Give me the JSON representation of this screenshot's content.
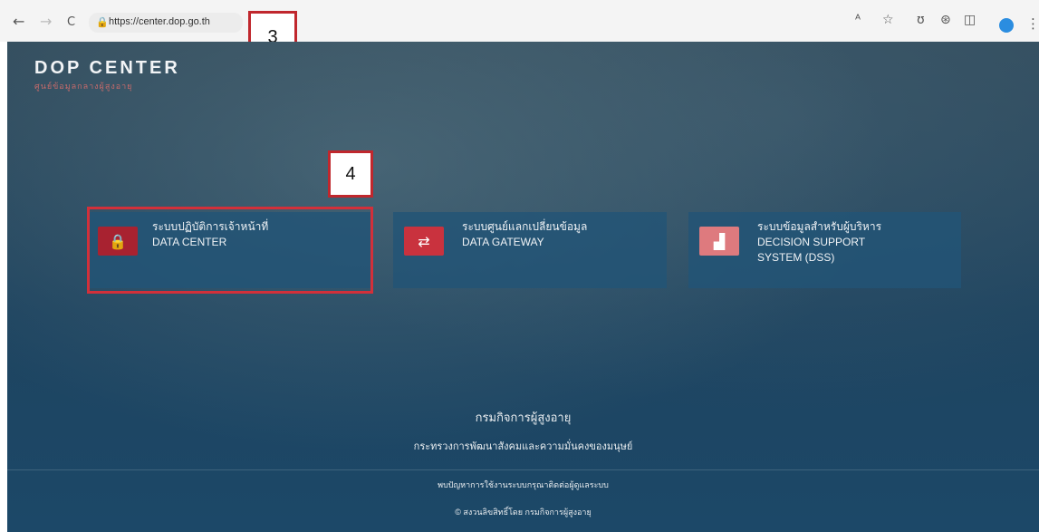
{
  "browser": {
    "back_icon": "←",
    "forward_icon": "→",
    "reload_icon": "C",
    "lock_icon": "🔒",
    "url": "https://center.dop.go.th",
    "extensions": [
      "translate-icon",
      "star-icon",
      "extension-icon",
      "sync-icon",
      "camera-icon"
    ],
    "ext_glyphs": [
      "ᴬ",
      "☆",
      "ʊ",
      "⊛",
      "◫"
    ],
    "kebab": "⋮"
  },
  "callouts": {
    "three": "3",
    "four": "4"
  },
  "header": {
    "title": "DOP CENTER",
    "subtitle": "ศูนย์ข้อมูลกลางผู้สูงอายุ"
  },
  "cards": [
    {
      "line1": "ระบบปฏิบัติการเจ้าหน้าที่",
      "line2": "DATA CENTER",
      "line3": "",
      "icon": "lock-icon",
      "glyph": "🔒",
      "color": "#a82230"
    },
    {
      "line1": "ระบบศูนย์แลกเปลี่ยนข้อมูล",
      "line2": "DATA GATEWAY",
      "line3": "",
      "icon": "exchange-icon",
      "glyph": "⇄",
      "color": "#c9323e"
    },
    {
      "line1": "ระบบข้อมูลสำหรับผู้บริหาร",
      "line2": "DECISION SUPPORT",
      "line3": "SYSTEM (DSS)",
      "icon": "chart-icon",
      "glyph": "▟",
      "color": "#de7a7e"
    }
  ],
  "footer": {
    "org": "กรมกิจการผู้สูงอายุ",
    "ministry": "กระทรวงการพัฒนาสังคมและความมั่นคงของมนุษย์",
    "contact": "พบปัญหาการใช้งานระบบกรุณาติดต่อผู้ดูแลระบบ",
    "copyright": "© สงวนลิขสิทธิ์โดย กรมกิจการผู้สูงอายุ"
  }
}
